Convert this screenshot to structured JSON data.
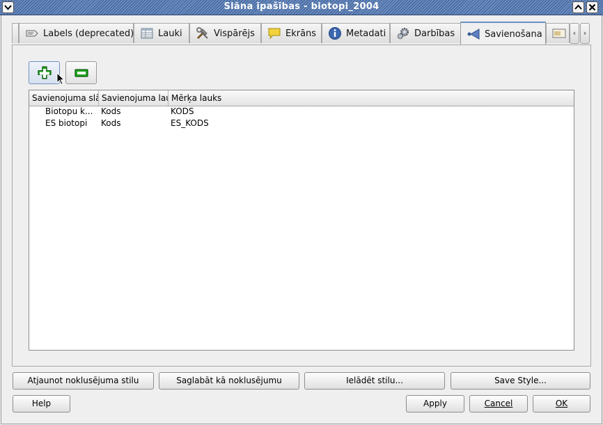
{
  "window": {
    "title": "Slāna īpašības - biotopi_2004"
  },
  "titlebar_buttons": [
    "chevron-down-icon",
    "chevron-up-icon",
    "close-icon"
  ],
  "tabs": [
    {
      "label": "Labels (deprecated)",
      "icon": "labels-icon",
      "active": false
    },
    {
      "label": "Lauki",
      "icon": "table-icon",
      "active": false
    },
    {
      "label": "Vispārējs",
      "icon": "tools-icon",
      "active": false
    },
    {
      "label": "Ekrāns",
      "icon": "speech-bubble-icon",
      "active": false
    },
    {
      "label": "Metadati",
      "icon": "info-icon",
      "active": false
    },
    {
      "label": "Darbības",
      "icon": "gears-icon",
      "active": false
    },
    {
      "label": "Savienošana",
      "icon": "join-icon",
      "active": true
    }
  ],
  "toolbar": {
    "add_icon": "add-icon",
    "remove_icon": "remove-icon"
  },
  "joins_table": {
    "columns": [
      "Savienojuma slāni",
      "Savienojuma lauks",
      "Mērķa lauks"
    ],
    "rows": [
      [
        "Biotopu k...",
        "Kods",
        "KODS"
      ],
      [
        "ES biotopi",
        "Kods",
        "ES_KODS"
      ]
    ]
  },
  "style_buttons": {
    "restore_default": "Atjaunot noklusējuma stilu",
    "save_default": "Saglabāt kā noklusējumu",
    "load_style": "Ielādēt stilu...",
    "save_style": "Save Style..."
  },
  "dialog_buttons": {
    "help": "Help",
    "apply": "Apply",
    "cancel": "Cancel",
    "ok": "OK"
  },
  "colors": {
    "titlebar": "#4f72a8",
    "add_icon_green": "#1fa51f",
    "remove_icon_green": "#1fa51f"
  }
}
